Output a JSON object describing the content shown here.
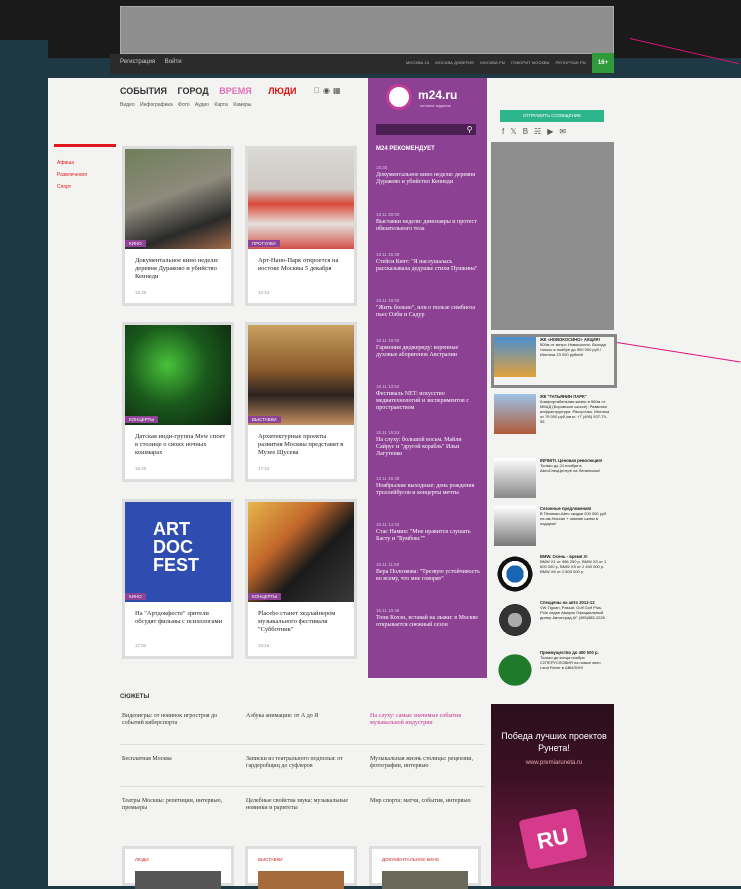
{
  "colors": {
    "accent": "#8c4193",
    "red": "#e2161e",
    "green": "#2e9a3a",
    "pink_annotation": "#e0107a"
  },
  "topbar": {
    "left": [
      "Регистрация",
      "Войти"
    ],
    "right": [
      "МОСКВА 24",
      "МОСКВА ДОВЕРИЕ",
      "МОСКВА FM",
      "ГОВОРИТ МОСКВА",
      "РЕПОРТАЖ FM"
    ],
    "age": "16+"
  },
  "main_nav": {
    "items": [
      "СОБЫТИЯ",
      "ГОРОД",
      "ВРЕМЯ",
      "ЛЮДИ"
    ]
  },
  "sub_nav": [
    "Видео",
    "Инфографика",
    "Фото",
    "Аудио",
    "Карта",
    "Камеры"
  ],
  "os_icons": [
    "apple-icon",
    "android-icon",
    "windows-icon"
  ],
  "sidebar": [
    "Афиша",
    "Развлечения",
    "Спорт"
  ],
  "cards": [
    {
      "tag": "КИНО",
      "title": "Документальное кино недели: деревня Дураково и убийство Кеннеди",
      "date": "15:36"
    },
    {
      "tag": "ПРОГУЛКИ",
      "title": "Арт-Нано-Парк откроется на востоке Москвы 5 декабря",
      "date": "15:24"
    },
    {
      "tag": "КОНЦЕРТЫ",
      "title": "Датская инди-группа Mew споет в столице о своих ночных кошмарах",
      "date": "16:40"
    },
    {
      "tag": "ВЫСТАВКИ",
      "title": "Архитектурные проекты развития Москвы представят в Музее Щусева",
      "date": "17:22"
    },
    {
      "tag": "КИНО",
      "title": "На \"Артдокфесте\" зрители обсудят фильмы с психологами",
      "date": "17:02"
    },
    {
      "tag": "КОНЦЕРТЫ",
      "title": "Placebo станет хедлайнером музыкального фестиваля \"Субботник\"",
      "date": "15:16"
    }
  ],
  "m24": {
    "logo": "m24.ru",
    "logo_sub": "сетевое издание",
    "rec_title": "M24 РЕКОМЕНДУЕТ",
    "news": [
      {
        "date": "15:35",
        "title": "Документальное кино недели: деревня Дураково и убийство Кеннеди"
      },
      {
        "date": "19.11 20:00",
        "title": "Выставки недели: динозавры и протест обязательного тела"
      },
      {
        "date": "19.11 15:28",
        "title": "Стейси Кент: \"Я наслушалась рассказывала дедушке стихи Пушкина\""
      },
      {
        "date": "19.11 19:06",
        "title": "\"Жить больно\", или о пользе симбиоза пьес Олби и Садур"
      },
      {
        "date": "18.11 19:30",
        "title": "Гармония диджериду: коренные духовые аборигенов Австралии"
      },
      {
        "date": "18.11 13:54",
        "title": "Фестиваль NET: искусство медиатехнологий и экспериментов с пространством"
      },
      {
        "date": "15.11 16:53",
        "title": "На слуху: большой восьм. Майли Сайрус и \"другой корабль\" Ильи Лагутенко"
      },
      {
        "date": "13.11 16:48",
        "title": "Ноябрьские выходные: день рождения троллейбусов и концерты мечты"
      },
      {
        "date": "15.11 14:34",
        "title": "Стас Намин: \"Мне нравится слушать Басту и \"Бумбокс\"\""
      },
      {
        "date": "15.11 11:58",
        "title": "Вера Полозкова: \"Трезвую устойчивость во всему, что мне говорят\""
      },
      {
        "date": "15.11 10:46",
        "title": "Тони Кохэн, вставай на лыжи: в Москве открывается снежный сезон"
      }
    ]
  },
  "right": {
    "follow": "ОТПРАВИТЬ СООБЩЕНИЕ",
    "social": [
      "f",
      "𝕏",
      "B",
      "☵",
      "▶",
      "✉"
    ],
    "ads": [
      {
        "title": "ЖК «НОВОКОСИНО» АКЦИЯ!",
        "text": "500м от метро Новокосино. Выгода только в ноябре до 500 000 руб.! Ипотека 23 000 рублей"
      },
      {
        "title": "ЖК \"ТАТЬЯНИН ПАРК\"",
        "text": "Комфортабельная жизнь в 500м от МКАД (Боровское шоссе). Развитая инфраструктура. Рассрочка. Ипотека от 79 000 руб./кв.м. +7 (495) 937-79-55"
      },
      {
        "title": "INFINITI. Ценовая революция!",
        "text": "Только до 24 ноября в АвтоСпецЦентре на Ленинском!"
      },
      {
        "title": "Сезонные предложения!",
        "text": "В Пеликан-Авто скидки 200 000 руб на ам.Ниссан + зимние шины в подарок!"
      },
      {
        "title": "BMW. Осень - время X!",
        "text": "BMW X1 от 986 250 р. BMW X3 от 1 600 000 р. BMW X5 от 2 490 000 р. BMW X6 от 2 800 000 р."
      },
      {
        "title": "Спеццены на авто 2012-13",
        "text": "VW Tiguan, Passat, Golf Golf Plus, Polo седан Амарок Официальный дилер Автогерад АГ (495)585-2226"
      },
      {
        "title": "Преимущество до 400 000 р.",
        "text": "Только до конца ноября СУПЕРУСЛОВИЯ на новые авто Land Rover в АВИЛОН!"
      }
    ],
    "promo_title": "Победа лучших проектов Рунета!",
    "promo_url": "www.premiaruneta.ru",
    "promo_badge": "RU"
  },
  "stories": {
    "title": "СЮЖЕТЫ",
    "items": [
      {
        "text": "Видеоигры: от новинок игростроя до событий киберспорта",
        "pink": false
      },
      {
        "text": "Азбука анимации: от А до Я",
        "pink": false
      },
      {
        "text": "На слуху: самые значимые события музыкальной индустрии",
        "pink": true
      },
      {
        "text": "Бесплатная Москва",
        "pink": false
      },
      {
        "text": "Записки из театрального подполья: от гардеробщиц до суфлеров",
        "pink": false
      },
      {
        "text": "Музыкальная жизнь столицы: рецензии, фотографии, интервью",
        "pink": false
      },
      {
        "text": "Театры Москвы: репетиции, интервью, премьеры",
        "pink": false
      },
      {
        "text": "Целебные свойства звука: музыкальные новинки и раритеты",
        "pink": false
      },
      {
        "text": "Мир спорта: матчи, события, интервью",
        "pink": false
      }
    ]
  },
  "bottom_tags": [
    "ЛЮДИ",
    "ВЫСТАВКИ",
    "ДОКУМЕНТАЛЬНОЕ КИНО"
  ]
}
